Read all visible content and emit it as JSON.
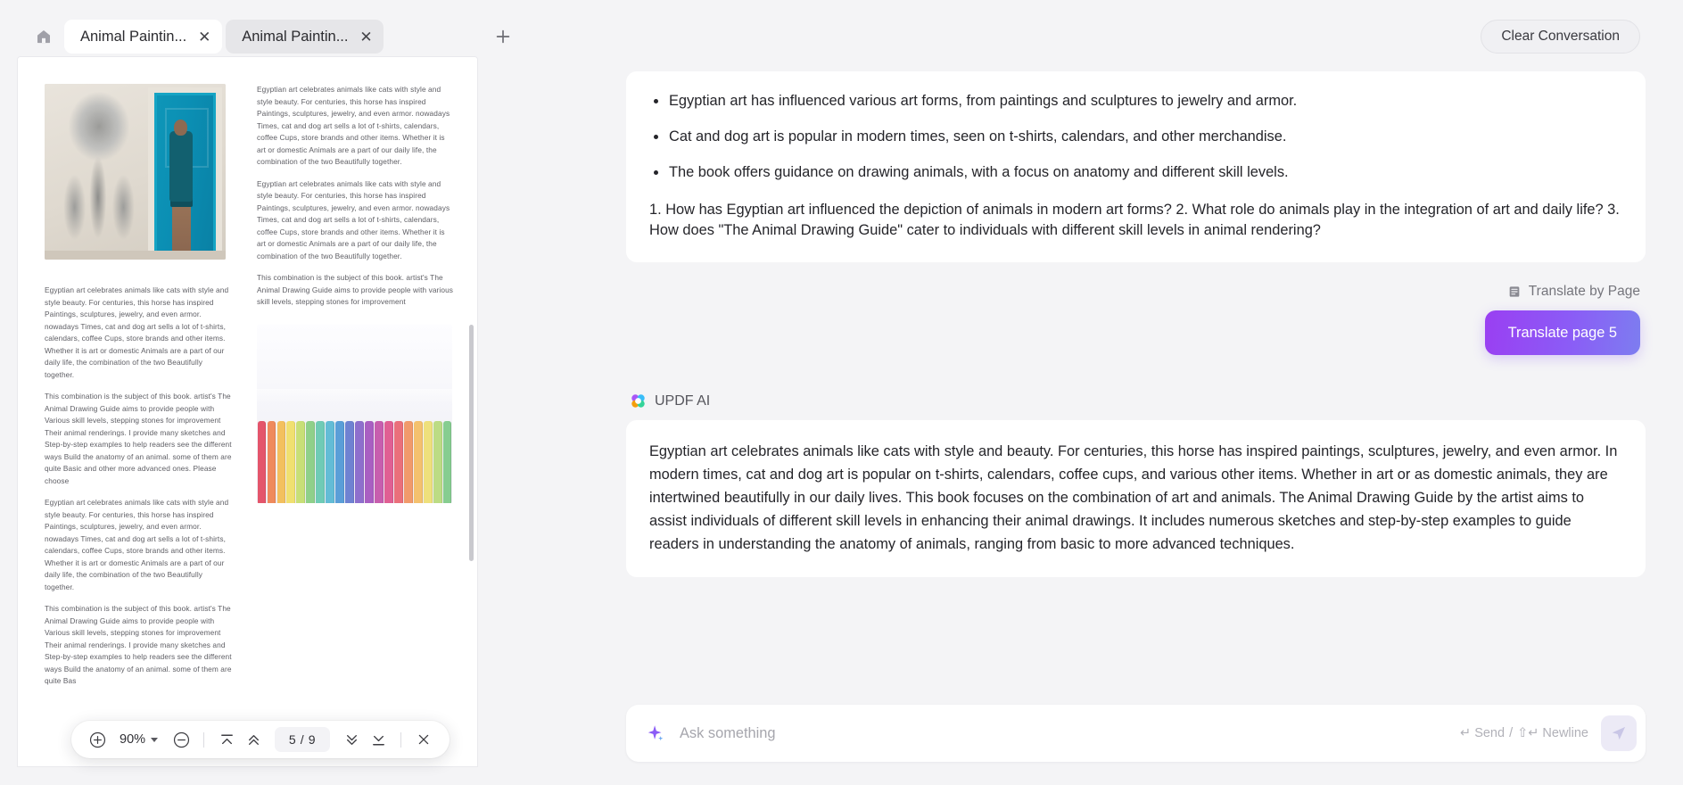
{
  "window": {
    "tabs": [
      {
        "label": "Animal Paintin...",
        "active": true,
        "close": "✕"
      },
      {
        "label": "Animal Paintin...",
        "active": false,
        "close": "✕"
      }
    ],
    "home_icon": "home-icon",
    "new_tab_icon": "plus-icon"
  },
  "pdf": {
    "toolbar": {
      "zoom_in": "+",
      "zoom_level": "90%",
      "zoom_out": "−",
      "first_page_icon": "go-to-first-page-icon",
      "prev_page_icon": "previous-page-icon",
      "page_indicator": "5 / 9",
      "next_page_icon": "next-page-icon",
      "last_page_icon": "go-to-last-page-icon",
      "close_icon": "close-icon"
    },
    "page_number": 5,
    "total_pages": 9,
    "column_left_blocks": [
      "Egyptian art celebrates animals like cats with style and style beauty. For centuries, this horse has inspired Paintings, sculptures, jewelry, and even armor. nowadays Times, cat and dog art sells a lot of t-shirts, calendars, coffee Cups, store brands and other items. Whether it is art or domestic Animals are a part of our daily life, the combination of the two Beautifully together.",
      "This combination is the subject of this book. artist's The Animal Drawing Guide aims to provide people with Various skill levels, stepping stones for improvement Their animal renderings. I provide many sketches and Step-by-step examples to help readers see the different ways Build the anatomy of an animal. some of them are quite Basic and other more advanced ones. Please choose",
      "Egyptian art celebrates animals like cats with style and style beauty. For centuries, this horse has inspired Paintings, sculptures, jewelry, and even armor. nowadays Times, cat and dog art sells a lot of t-shirts, calendars, coffee Cups, store brands and other items. Whether it is art or domestic Animals are a part of our daily life, the combination of the two Beautifully together.",
      "This combination is the subject of this book. artist's The Animal Drawing Guide aims to provide people with Various skill levels, stepping stones for improvement Their animal renderings. I provide many sketches and Step-by-step examples to help readers see the different ways Build the anatomy of an animal. some of them are quite Bas"
    ],
    "column_right_blocks": [
      "Egyptian art celebrates animals like cats with style and style beauty. For centuries, this horse has inspired Paintings, sculptures, jewelry, and even armor. nowadays Times, cat and dog art sells a lot of t-shirts, calendars, coffee Cups, store brands and other items. Whether it is art or domestic Animals are a part of our daily life, the combination of the two Beautifully together.",
      "Egyptian art celebrates animals like cats with style and style beauty. For centuries, this horse has inspired Paintings, sculptures, jewelry, and even armor. nowadays Times, cat and dog art sells a lot of t-shirts, calendars, coffee Cups, store brands and other items. Whether it is art or domestic Animals are a part of our daily life, the combination of the two Beautifully together.",
      "This combination is the subject of this book. artist's The Animal Drawing Guide aims to provide people with various skill levels, stepping stones for improvement"
    ],
    "images": {
      "top": "elephant-drawing-and-man-by-blue-door-photo",
      "bottom": "colored-pencils-photo"
    }
  },
  "ai": {
    "clear_label": "Clear Conversation",
    "summary_bullets": [
      "Egyptian art has influenced various art forms, from paintings and sculptures to jewelry and armor.",
      "Cat and dog art is popular in modern times, seen on t-shirts, calendars, and other merchandise.",
      "The book offers guidance on drawing animals, with a focus on anatomy and different skill levels."
    ],
    "questions": "1. How has Egyptian art influenced the depiction of animals in modern art forms? 2. What role do animals play in the integration of art and daily life? 3. How does \"The Animal Drawing Guide\" cater to individuals with different skill levels in animal rendering?",
    "translate_by_page_label": "Translate by Page",
    "translate_by_page_icon": "page-list-icon",
    "translate_button_label": "Translate page 5",
    "assistant_name": "UPDF AI",
    "assistant_logo": "updf-ai-clover-logo",
    "answer": "Egyptian art celebrates animals like cats with style and beauty. For centuries, this horse has inspired paintings, sculptures, jewelry, and even armor. In modern times, cat and dog art is popular on t-shirts, calendars, coffee cups, and various other items. Whether in art or as domestic animals, they are intertwined beautifully in our daily lives. This book focuses on the combination of art and animals. The Animal Drawing Guide by the artist aims to assist individuals of different skill levels in enhancing their animal drawings. It includes numerous sketches and step-by-step examples to guide readers in understanding the anatomy of animals, ranging from basic to more advanced techniques.",
    "composer": {
      "placeholder": "Ask something",
      "value": "",
      "sparkle_icon": "sparkle-icon",
      "hint_send": "↵ Send",
      "hint_divider": "/",
      "hint_newline": "⇧↵ Newline",
      "send_icon": "send-icon"
    }
  },
  "colors": {
    "accent_purple": "#8b5cf6",
    "gradient_from": "#9a3ff2",
    "gradient_to": "#7d7df0",
    "panel_bg": "#f4f4f6",
    "card_bg": "#ffffff",
    "door_blue": "#0b8fb4"
  }
}
